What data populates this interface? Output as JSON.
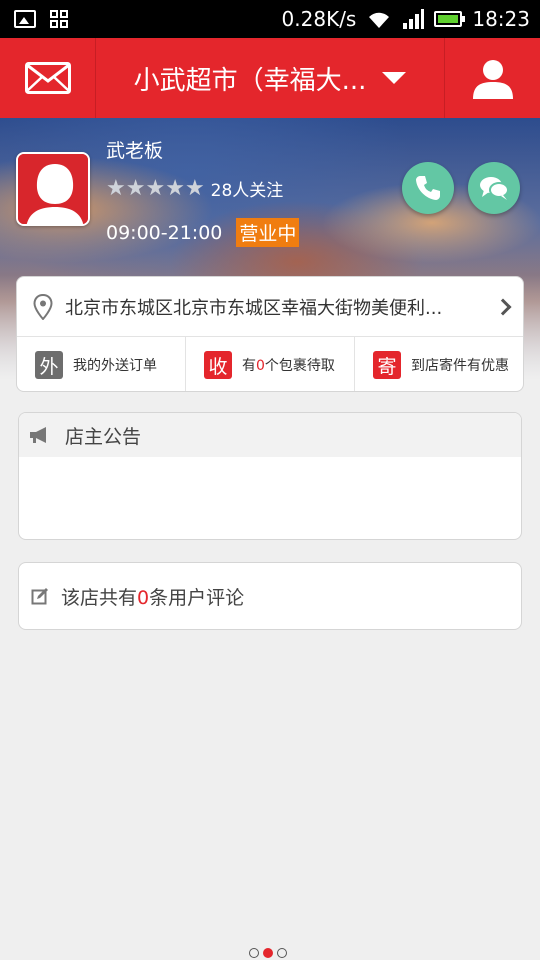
{
  "status_bar": {
    "net_speed": "0.28K/s",
    "time": "18:23",
    "icons": [
      "image-icon",
      "qr-icon",
      "wifi-icon",
      "signal-icon",
      "battery-icon"
    ]
  },
  "header": {
    "title": "小武超市（幸福大...",
    "left_icon": "mail-icon",
    "right_icon": "user-icon",
    "accent": "#e4262c"
  },
  "shop": {
    "owner": "武老板",
    "rating": 5,
    "followers": "28人关注",
    "hours": "09:00-21:00",
    "status": "营业中",
    "status_color": "#f07d10",
    "action_color": "#63c7a4"
  },
  "address": {
    "text": "北京市东城区北京市东城区幸福大街物美便利..."
  },
  "quick_actions": [
    {
      "badge": "外",
      "badge_color": "#6d6d6d",
      "label": "我的外送订单"
    },
    {
      "badge": "收",
      "badge_color": "#e4262c",
      "prefix": "有",
      "count": "0",
      "suffix": "个包裹待取"
    },
    {
      "badge": "寄",
      "badge_color": "#e4262c",
      "label": "到店寄件有优惠"
    }
  ],
  "notice": {
    "title": "店主公告"
  },
  "comments": {
    "prefix": "该店共有",
    "count": "0",
    "suffix": "条用户评论"
  },
  "pager": {
    "total": 3,
    "active": 2
  }
}
